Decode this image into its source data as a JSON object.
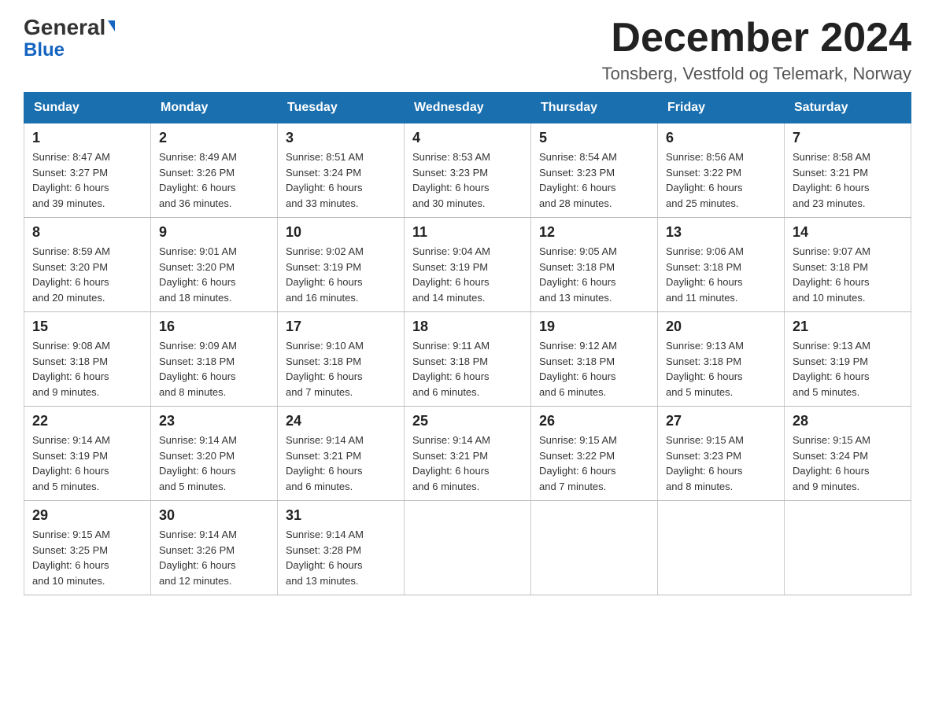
{
  "header": {
    "logo_general": "General",
    "logo_blue": "Blue",
    "month_title": "December 2024",
    "subtitle": "Tonsberg, Vestfold og Telemark, Norway"
  },
  "weekdays": [
    "Sunday",
    "Monday",
    "Tuesday",
    "Wednesday",
    "Thursday",
    "Friday",
    "Saturday"
  ],
  "weeks": [
    [
      {
        "day": "1",
        "sunrise": "8:47 AM",
        "sunset": "3:27 PM",
        "daylight": "6 hours and 39 minutes."
      },
      {
        "day": "2",
        "sunrise": "8:49 AM",
        "sunset": "3:26 PM",
        "daylight": "6 hours and 36 minutes."
      },
      {
        "day": "3",
        "sunrise": "8:51 AM",
        "sunset": "3:24 PM",
        "daylight": "6 hours and 33 minutes."
      },
      {
        "day": "4",
        "sunrise": "8:53 AM",
        "sunset": "3:23 PM",
        "daylight": "6 hours and 30 minutes."
      },
      {
        "day": "5",
        "sunrise": "8:54 AM",
        "sunset": "3:23 PM",
        "daylight": "6 hours and 28 minutes."
      },
      {
        "day": "6",
        "sunrise": "8:56 AM",
        "sunset": "3:22 PM",
        "daylight": "6 hours and 25 minutes."
      },
      {
        "day": "7",
        "sunrise": "8:58 AM",
        "sunset": "3:21 PM",
        "daylight": "6 hours and 23 minutes."
      }
    ],
    [
      {
        "day": "8",
        "sunrise": "8:59 AM",
        "sunset": "3:20 PM",
        "daylight": "6 hours and 20 minutes."
      },
      {
        "day": "9",
        "sunrise": "9:01 AM",
        "sunset": "3:20 PM",
        "daylight": "6 hours and 18 minutes."
      },
      {
        "day": "10",
        "sunrise": "9:02 AM",
        "sunset": "3:19 PM",
        "daylight": "6 hours and 16 minutes."
      },
      {
        "day": "11",
        "sunrise": "9:04 AM",
        "sunset": "3:19 PM",
        "daylight": "6 hours and 14 minutes."
      },
      {
        "day": "12",
        "sunrise": "9:05 AM",
        "sunset": "3:18 PM",
        "daylight": "6 hours and 13 minutes."
      },
      {
        "day": "13",
        "sunrise": "9:06 AM",
        "sunset": "3:18 PM",
        "daylight": "6 hours and 11 minutes."
      },
      {
        "day": "14",
        "sunrise": "9:07 AM",
        "sunset": "3:18 PM",
        "daylight": "6 hours and 10 minutes."
      }
    ],
    [
      {
        "day": "15",
        "sunrise": "9:08 AM",
        "sunset": "3:18 PM",
        "daylight": "6 hours and 9 minutes."
      },
      {
        "day": "16",
        "sunrise": "9:09 AM",
        "sunset": "3:18 PM",
        "daylight": "6 hours and 8 minutes."
      },
      {
        "day": "17",
        "sunrise": "9:10 AM",
        "sunset": "3:18 PM",
        "daylight": "6 hours and 7 minutes."
      },
      {
        "day": "18",
        "sunrise": "9:11 AM",
        "sunset": "3:18 PM",
        "daylight": "6 hours and 6 minutes."
      },
      {
        "day": "19",
        "sunrise": "9:12 AM",
        "sunset": "3:18 PM",
        "daylight": "6 hours and 6 minutes."
      },
      {
        "day": "20",
        "sunrise": "9:13 AM",
        "sunset": "3:18 PM",
        "daylight": "6 hours and 5 minutes."
      },
      {
        "day": "21",
        "sunrise": "9:13 AM",
        "sunset": "3:19 PM",
        "daylight": "6 hours and 5 minutes."
      }
    ],
    [
      {
        "day": "22",
        "sunrise": "9:14 AM",
        "sunset": "3:19 PM",
        "daylight": "6 hours and 5 minutes."
      },
      {
        "day": "23",
        "sunrise": "9:14 AM",
        "sunset": "3:20 PM",
        "daylight": "6 hours and 5 minutes."
      },
      {
        "day": "24",
        "sunrise": "9:14 AM",
        "sunset": "3:21 PM",
        "daylight": "6 hours and 6 minutes."
      },
      {
        "day": "25",
        "sunrise": "9:14 AM",
        "sunset": "3:21 PM",
        "daylight": "6 hours and 6 minutes."
      },
      {
        "day": "26",
        "sunrise": "9:15 AM",
        "sunset": "3:22 PM",
        "daylight": "6 hours and 7 minutes."
      },
      {
        "day": "27",
        "sunrise": "9:15 AM",
        "sunset": "3:23 PM",
        "daylight": "6 hours and 8 minutes."
      },
      {
        "day": "28",
        "sunrise": "9:15 AM",
        "sunset": "3:24 PM",
        "daylight": "6 hours and 9 minutes."
      }
    ],
    [
      {
        "day": "29",
        "sunrise": "9:15 AM",
        "sunset": "3:25 PM",
        "daylight": "6 hours and 10 minutes."
      },
      {
        "day": "30",
        "sunrise": "9:14 AM",
        "sunset": "3:26 PM",
        "daylight": "6 hours and 12 minutes."
      },
      {
        "day": "31",
        "sunrise": "9:14 AM",
        "sunset": "3:28 PM",
        "daylight": "6 hours and 13 minutes."
      },
      null,
      null,
      null,
      null
    ]
  ],
  "labels": {
    "sunrise": "Sunrise:",
    "sunset": "Sunset:",
    "daylight": "Daylight:"
  }
}
